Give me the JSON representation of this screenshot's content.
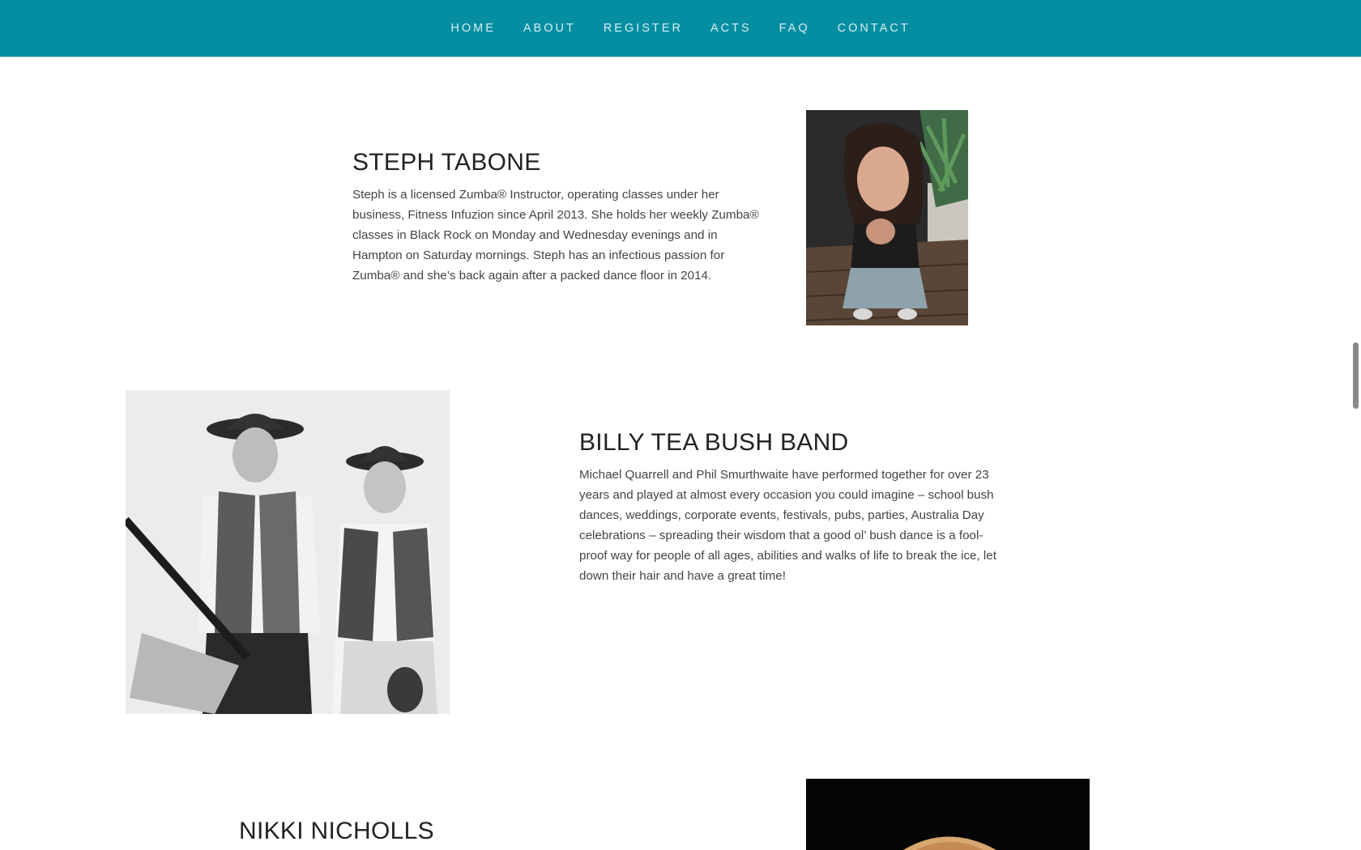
{
  "nav": {
    "items": [
      {
        "label": "HOME"
      },
      {
        "label": "ABOUT"
      },
      {
        "label": "REGISTER"
      },
      {
        "label": "ACTS"
      },
      {
        "label": "FAQ"
      },
      {
        "label": "CONTACT"
      }
    ]
  },
  "acts": [
    {
      "name": "STEPH TABONE",
      "description": "Steph is a licensed Zumba® Instructor, operating classes under her business, Fitness Infuzion since April 2013. She holds her weekly Zumba® classes in Black Rock on Monday and Wednesday evenings and in Hampton on Saturday mornings. Steph has an infectious passion for Zumba® and she’s back again after a packed dance floor in 2014."
    },
    {
      "name": "BILLY TEA BUSH BAND",
      "description": "Michael Quarrell and Phil Smurthwaite have performed together for over 23 years and played at almost every occasion you could imagine – school bush dances, weddings, corporate events, festivals, pubs, parties, Australia Day celebrations – spreading their wisdom that a good ol’ bush dance is a fool-proof way for people of all ages, abilities and walks of life to break the ice, let down their hair and have a great time!"
    },
    {
      "name": "NIKKI NICHOLLS"
    }
  ],
  "colors": {
    "nav_bg": "#058ea1",
    "nav_text": "#d6eef2"
  }
}
